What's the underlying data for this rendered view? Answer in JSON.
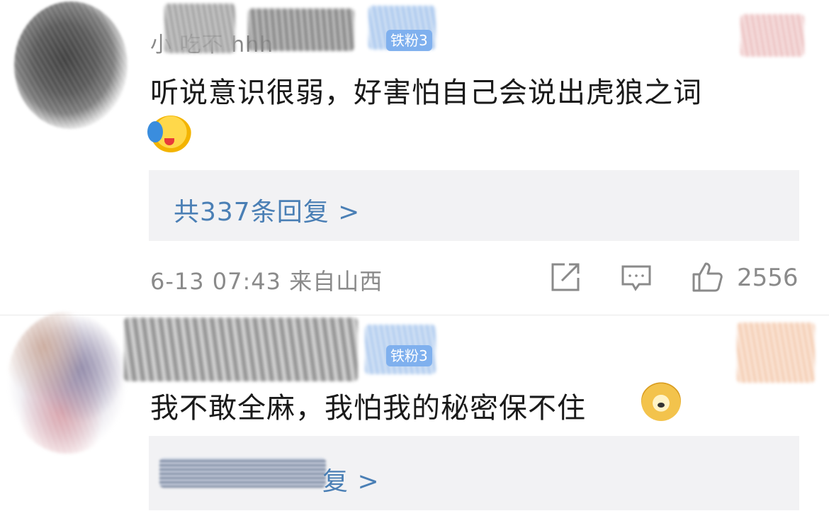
{
  "comments": [
    {
      "username_visible": "小  吃不   hhh",
      "badge": "铁粉3",
      "text": "听说意识很弱，好害怕自己会说出虎狼之词",
      "emoji": "hug-emoji",
      "replies_label": "共337条回复 >",
      "date": "6-13 07:43",
      "location": "来自山西",
      "like_count": "2556"
    },
    {
      "badge": "铁粉3",
      "text": "我不敢全麻，我怕我的秘密保不住",
      "emoji": "doge-emoji",
      "replies_label": "复 >"
    }
  ],
  "icons": {
    "share": "share-icon",
    "comment": "comment-icon",
    "like": "thumbs-up-icon"
  },
  "colors": {
    "link": "#4a7fb5",
    "badge": "#7fb0ee",
    "reply_bg": "#f2f2f4",
    "meta": "#8a8a8a"
  }
}
